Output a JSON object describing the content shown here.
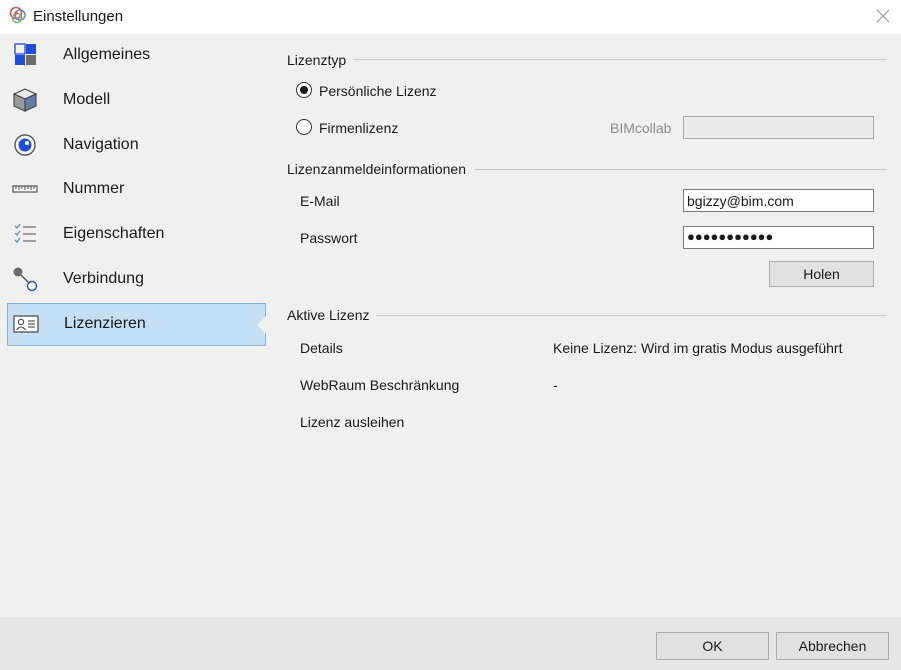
{
  "window": {
    "title": "Einstellungen",
    "icon": "bimcollab-logo-icon"
  },
  "sidebar": {
    "items": [
      {
        "label": "Allgemeines",
        "icon": "tiles-icon"
      },
      {
        "label": "Modell",
        "icon": "cube-icon"
      },
      {
        "label": "Navigation",
        "icon": "eye-icon"
      },
      {
        "label": "Nummer",
        "icon": "ruler-icon"
      },
      {
        "label": "Eigenschaften",
        "icon": "checklist-icon"
      },
      {
        "label": "Verbindung",
        "icon": "link-icon"
      },
      {
        "label": "Lizenzieren",
        "icon": "id-card-icon",
        "selected": true
      }
    ]
  },
  "license_type": {
    "title": "Lizenztyp",
    "personal_label": "Persönliche Lizenz",
    "company_label": "Firmenlizenz",
    "selected": "personal",
    "bimcollab_label": "BIMcollab",
    "bimcollab_value": ""
  },
  "credentials": {
    "title": "Lizenzanmeldeinformationen",
    "email_label": "E-Mail",
    "email_value": "bgizzy@bim.com",
    "password_label": "Passwort",
    "password_masked": "●●●●●●●●●●●",
    "fetch_button": "Holen"
  },
  "active_license": {
    "title": "Aktive Lizenz",
    "details_label": "Details",
    "details_value": "Keine Lizenz: Wird im gratis Modus ausgeführt",
    "webroom_label": "WebRaum Beschränkung",
    "webroom_value": "-",
    "borrow_label": "Lizenz ausleihen"
  },
  "footer": {
    "ok_label": "OK",
    "cancel_label": "Abbrechen"
  },
  "colors": {
    "accent": "#1e4fd6",
    "selection": "#c5dff5",
    "selection_border": "#7eb4e2",
    "panel": "#f0f0f0"
  }
}
